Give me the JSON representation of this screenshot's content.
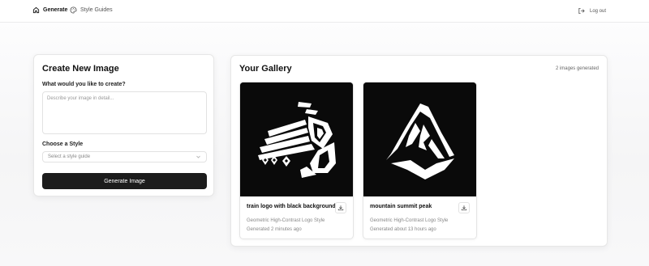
{
  "nav": {
    "generate": "Generate",
    "style_guides": "Style Guides",
    "logout": "Log out"
  },
  "create": {
    "title": "Create New Image",
    "prompt_label": "What would you like to create?",
    "prompt_placeholder": "Describe your image in detail...",
    "prompt_value": "",
    "style_label": "Choose a Style",
    "style_placeholder": "Select a style guide",
    "button_label": "Generate Image"
  },
  "gallery": {
    "title": "Your Gallery",
    "count": "2 images generated",
    "images": [
      {
        "title": "train logo with black background",
        "style": "Geometric High-Contrast Logo Style",
        "generated": "Generated 2 minutes ago",
        "icon": "train-logo-image"
      },
      {
        "title": "mountain summit peak",
        "style": "Geometric High-Contrast Logo Style",
        "generated": "Generated about 13 hours ago",
        "icon": "mountain-logo-image"
      }
    ]
  },
  "colors": {
    "primary_button": "#1c1c1c",
    "image_bg": "#0a0a0a",
    "muted_text": "#888888"
  }
}
